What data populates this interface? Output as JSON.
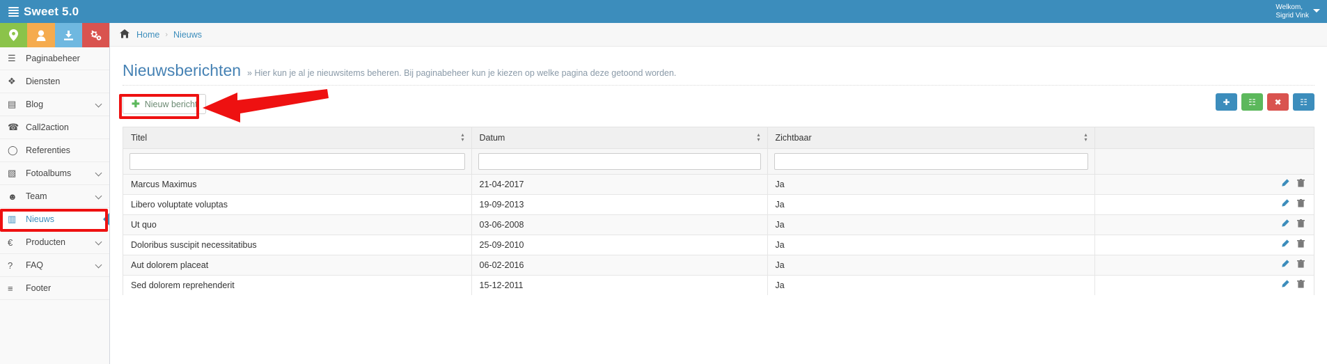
{
  "topbar": {
    "brand": "Sweet 5.0",
    "brand_icon": "server-stack-icon",
    "user_greeting": "Welkom,",
    "user_name": "Sigrid Vink",
    "caret_icon": "caret-down-icon",
    "bg_color": "#3c8dbc"
  },
  "sidebar": {
    "quick_buttons": [
      {
        "name": "location-button",
        "icon": "map-marker-icon",
        "glyph": "⊙",
        "color": "#8bc34a"
      },
      {
        "name": "user-button",
        "icon": "user-icon",
        "glyph": "●",
        "color": "#f5ab4e"
      },
      {
        "name": "download-button",
        "icon": "download-icon",
        "glyph": "⤓",
        "color": "#6fb8e0"
      },
      {
        "name": "settings-button",
        "icon": "cogs-icon",
        "glyph": "⚙",
        "color": "#d9534f"
      }
    ],
    "items": [
      {
        "label": "Paginabeheer",
        "icon": "bars-icon",
        "glyph": "☰",
        "caret": false,
        "active": false
      },
      {
        "label": "Diensten",
        "icon": "cubes-icon",
        "glyph": "❖",
        "caret": false,
        "active": false
      },
      {
        "label": "Blog",
        "icon": "file-text-icon",
        "glyph": "▤",
        "caret": true,
        "active": false
      },
      {
        "label": "Call2action",
        "icon": "bullhorn-phone-icon",
        "glyph": "☎",
        "caret": false,
        "active": false
      },
      {
        "label": "Referenties",
        "icon": "comment-icon",
        "glyph": "◯",
        "caret": false,
        "active": false
      },
      {
        "label": "Fotoalbums",
        "icon": "book-icon",
        "glyph": "▧",
        "caret": true,
        "active": false
      },
      {
        "label": "Team",
        "icon": "users-icon",
        "glyph": "☻",
        "caret": true,
        "active": false
      },
      {
        "label": "Nieuws",
        "icon": "newspaper-icon",
        "glyph": "▥",
        "caret": false,
        "active": true
      },
      {
        "label": "Producten",
        "icon": "euro-icon",
        "glyph": "€",
        "caret": true,
        "active": false
      },
      {
        "label": "FAQ",
        "icon": "question-circle-icon",
        "glyph": "?",
        "caret": true,
        "active": false
      },
      {
        "label": "Footer",
        "icon": "list-icon",
        "glyph": "≡",
        "caret": false,
        "active": false
      }
    ],
    "highlight_color": "#ee1111"
  },
  "breadcrumb": {
    "home_icon": "home-icon",
    "home": "Home",
    "separator": "›",
    "current": "Nieuws"
  },
  "page": {
    "title": "Nieuwsberichten",
    "subtitle": "» Hier kun je al je nieuwsitems beheren. Bij paginabeheer kun je kiezen op welke pagina deze getoond worden."
  },
  "toolbar": {
    "new_label": "Nieuw bericht",
    "new_icon": "plus-icon",
    "new_plus": "✚",
    "buttons": [
      {
        "name": "add-button",
        "icon": "plus-icon",
        "glyph": "✚",
        "color": "#3c8dbc"
      },
      {
        "name": "export-excel-button",
        "icon": "file-excel-icon",
        "glyph": "☷",
        "color": "#5cb85c"
      },
      {
        "name": "delete-button",
        "icon": "times-icon",
        "glyph": "✖",
        "color": "#d9534f"
      },
      {
        "name": "columns-button",
        "icon": "table-columns-icon",
        "glyph": "☷",
        "color": "#3c8dbc"
      }
    ]
  },
  "table": {
    "columns": [
      {
        "label": "Titel",
        "sortable": true
      },
      {
        "label": "Datum",
        "sortable": true
      },
      {
        "label": "Zichtbaar",
        "sortable": true
      },
      {
        "label": "",
        "sortable": false
      }
    ],
    "filters": [
      {
        "name": "filter-titel",
        "value": "",
        "placeholder": ""
      },
      {
        "name": "filter-datum",
        "value": "",
        "placeholder": ""
      },
      {
        "name": "filter-zichtbaar",
        "value": "",
        "placeholder": ""
      }
    ],
    "rows": [
      {
        "titel": "Marcus Maximus",
        "datum": "21-04-2017",
        "zichtbaar": "Ja"
      },
      {
        "titel": "Libero voluptate voluptas",
        "datum": "19-09-2013",
        "zichtbaar": "Ja"
      },
      {
        "titel": "Ut quo",
        "datum": "03-06-2008",
        "zichtbaar": "Ja"
      },
      {
        "titel": "Doloribus suscipit necessitatibus",
        "datum": "25-09-2010",
        "zichtbaar": "Ja"
      },
      {
        "titel": "Aut dolorem placeat",
        "datum": "06-02-2016",
        "zichtbaar": "Ja"
      },
      {
        "titel": "Sed dolorem reprehenderit",
        "datum": "15-12-2011",
        "zichtbaar": "Ja"
      }
    ],
    "row_actions": [
      {
        "name": "edit-row-icon",
        "icon": "pencil-icon",
        "glyph": "✎"
      },
      {
        "name": "delete-row-icon",
        "icon": "trash-icon",
        "glyph": "Ὕ1"
      }
    ]
  }
}
